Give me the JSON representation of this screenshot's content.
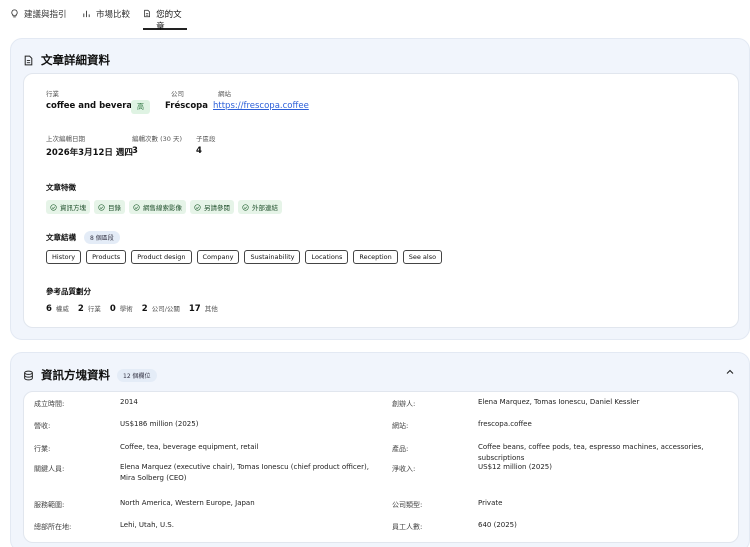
{
  "tabs": [
    {
      "label": "建議與指引",
      "icon": "lightbulb-icon"
    },
    {
      "label": "市場比較",
      "icon": "bar-chart-icon"
    },
    {
      "label": "您的文章",
      "icon": "document-icon",
      "active": true
    }
  ],
  "details": {
    "title": "文章詳細資料",
    "industry_label": "行業",
    "industry_value": "coffee and beverages",
    "industry_badge": "高",
    "company_label": "公司",
    "company_value": "Fréscopa",
    "website_label": "網站",
    "website_value": "https://frescopa.coffee",
    "last_edited_label": "上次編輯日期",
    "last_edited_value": "2026年3月12日 週四",
    "editors_label": "編輯次數 (30 天)",
    "editors_value": "3",
    "subsections_label": "子區段",
    "subsections_value": "4",
    "features_title": "文章特徵",
    "features": [
      "資訊方塊",
      "目錄",
      "網售線索影像",
      "另請參閱",
      "外部連結"
    ],
    "structure_title": "文章結構",
    "structure_badge": "8 個區段",
    "sections": [
      "History",
      "Products",
      "Product design",
      "Company",
      "Sustainability",
      "Locations",
      "Reception",
      "See also"
    ],
    "quality_title": "參考品質劃分",
    "quality": [
      {
        "count": "6",
        "label": "權威"
      },
      {
        "count": "2",
        "label": "行業"
      },
      {
        "count": "0",
        "label": "學術"
      },
      {
        "count": "2",
        "label": "公司/公關"
      },
      {
        "count": "17",
        "label": "其他"
      }
    ]
  },
  "infobox": {
    "title": "資訊方塊資料",
    "badge": "12 個欄位",
    "left": [
      {
        "key": "成立時間:",
        "value": "2014"
      },
      {
        "key": "營收:",
        "value": "US$186 million (2025)"
      },
      {
        "key": "行業:",
        "value": "Coffee, tea, beverage equipment, retail"
      },
      {
        "key": "關鍵人員:",
        "value": "Elena Marquez (executive chair), Tomas Ionescu (chief product officer), Mira Solberg (CEO)"
      },
      {
        "key": "服務範圍:",
        "value": "North America, Western Europe, Japan"
      },
      {
        "key": "總部所在地:",
        "value": "Lehi, Utah, U.S."
      }
    ],
    "right": [
      {
        "key": "創辦人:",
        "value": "Elena Marquez, Tomas Ionescu, Daniel Kessler"
      },
      {
        "key": "網站:",
        "value": "frescopa.coffee"
      },
      {
        "key": "產品:",
        "value": "Coffee beans, coffee pods, tea, espresso machines, accessories, subscriptions"
      },
      {
        "key": "淨收入:",
        "value": "US$12 million (2025)"
      },
      {
        "key": "公司類型:",
        "value": "Private"
      },
      {
        "key": "員工人數:",
        "value": "640 (2025)"
      }
    ]
  }
}
